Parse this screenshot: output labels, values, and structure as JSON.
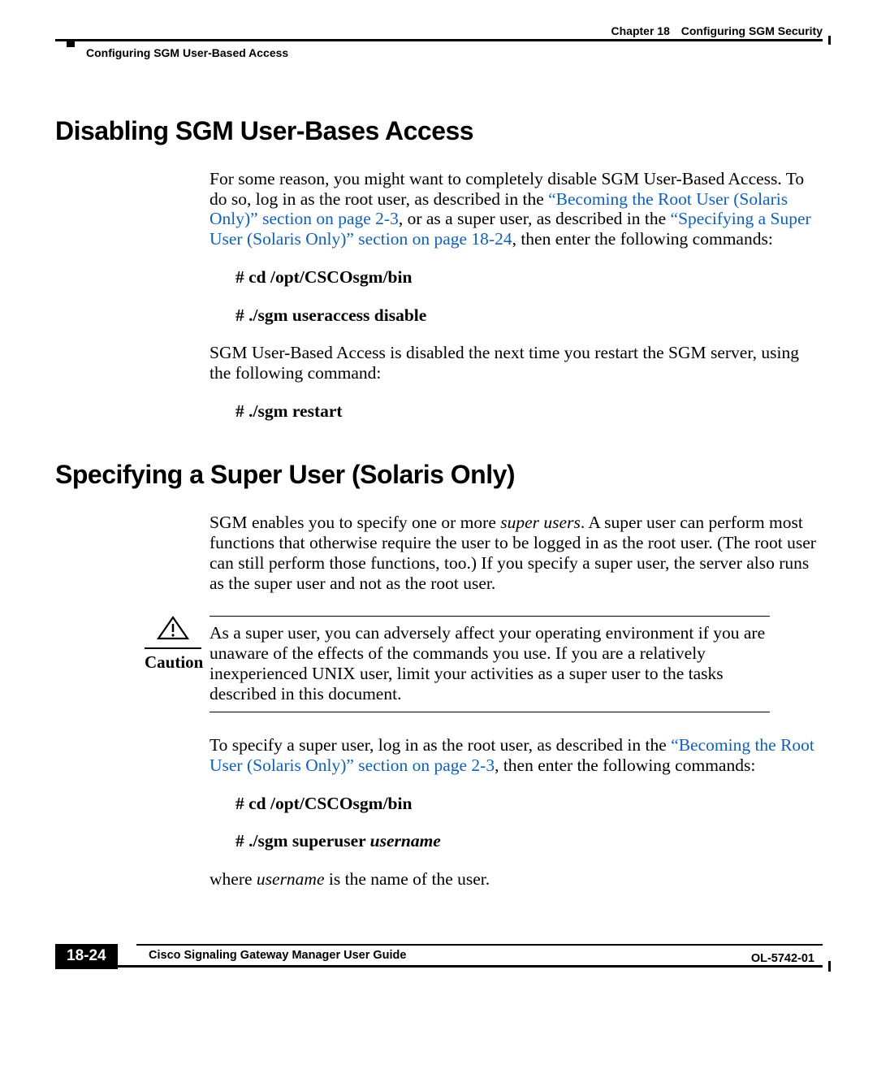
{
  "header": {
    "chapter_label": "Chapter 18",
    "chapter_title": "Configuring SGM Security",
    "section_title": "Configuring SGM User-Based Access"
  },
  "section1": {
    "heading": "Disabling SGM User-Bases Access",
    "para1_a": "For some reason, you might want to completely disable SGM User-Based Access. To do so, log in as the root user, as described in the ",
    "link1": "“Becoming the Root User (Solaris Only)” section on page 2-3",
    "para1_b": ", or as a super user, as described in the ",
    "link2": "“Specifying a Super User (Solaris Only)” section on page 18-24",
    "para1_c": ", then enter the following commands:",
    "cmd1": "# cd /opt/CSCOsgm/bin",
    "cmd2": "# ./sgm useraccess disable",
    "para2": "SGM User-Based Access is disabled the next time you restart the SGM server, using the following command:",
    "cmd3": "# ./sgm restart"
  },
  "section2": {
    "heading": "Specifying a Super User (Solaris Only)",
    "para1_a": "SGM enables you to specify one or more ",
    "para1_em": "super users",
    "para1_b": ". A super user can perform most functions that otherwise require the user to be logged in as the root user. (The root user can still perform those functions, too.) If you specify a super user, the server also runs as the super user and not as the root user.",
    "caution_label": "Caution",
    "caution_text": "As a super user, you can adversely affect your operating environment if you are unaware of the effects of the commands you use. If you are a relatively inexperienced UNIX user, limit your activities as a super user to the tasks described in this document.",
    "para2_a": "To specify a super user, log in as the root user, as described in the ",
    "link1": "“Becoming the Root User (Solaris Only)” section on page 2-3",
    "para2_b": ", then enter the following commands:",
    "cmd1": "# cd /opt/CSCOsgm/bin",
    "cmd2_a": "# ./sgm superuser ",
    "cmd2_em": "username",
    "para3_a": "where ",
    "para3_em": "username",
    "para3_b": " is the name of the user."
  },
  "footer": {
    "guide": "Cisco Signaling Gateway Manager User Guide",
    "page_num": "18-24",
    "doc_num": "OL-5742-01"
  }
}
